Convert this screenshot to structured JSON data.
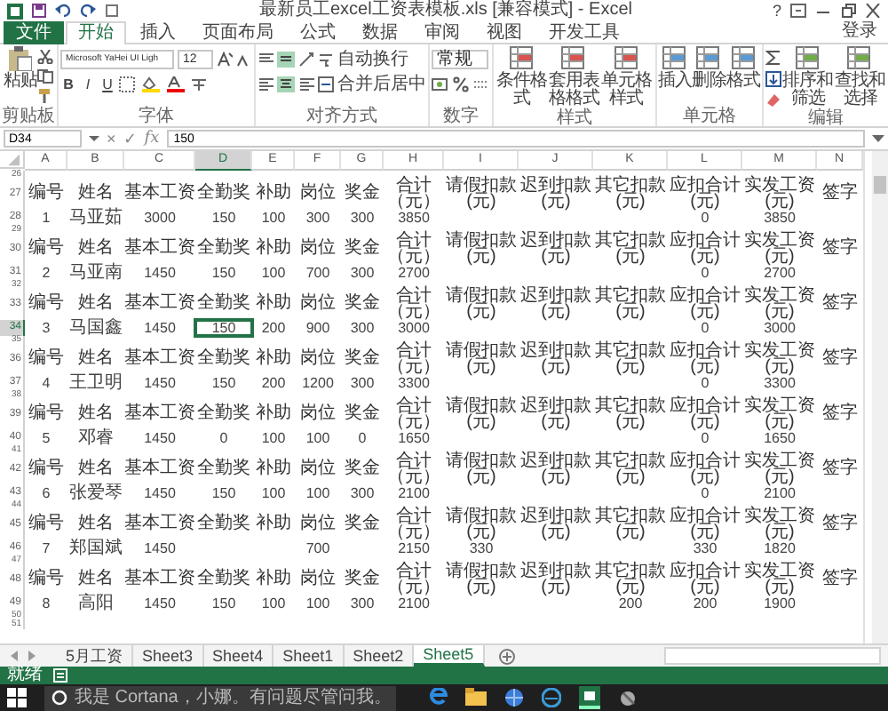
{
  "title_bar": {
    "title": "最新员工excel工资表模板.xls [兼容模式] - Excel",
    "help": "?"
  },
  "ribbon_tabs": [
    {
      "label": "文件",
      "kind": "file",
      "selected": false
    },
    {
      "label": "开始",
      "kind": "tab",
      "selected": true
    },
    {
      "label": "插入",
      "kind": "tab",
      "selected": false
    },
    {
      "label": "页面布局",
      "kind": "tab",
      "selected": false
    },
    {
      "label": "公式",
      "kind": "tab",
      "selected": false
    },
    {
      "label": "数据",
      "kind": "tab",
      "selected": false
    },
    {
      "label": "审阅",
      "kind": "tab",
      "selected": false
    },
    {
      "label": "视图",
      "kind": "tab",
      "selected": false
    },
    {
      "label": "开发工具",
      "kind": "tab",
      "selected": false
    }
  ],
  "account": "登录",
  "ribbon_groups": [
    {
      "label": "剪贴板",
      "items": [
        {
          "kind": "large",
          "label": "粘贴"
        },
        {
          "kind": "clip-tools"
        }
      ]
    },
    {
      "label": "字体",
      "items": [
        {
          "kind": "font-controls",
          "font": "Microsoft YaHei UI Ligh",
          "size": "12",
          "styles": [
            "B",
            "I",
            "U"
          ]
        }
      ]
    },
    {
      "label": "对齐方式",
      "items": [
        {
          "kind": "align-controls",
          "wrap": "自动换行",
          "merge": "合并后居中"
        }
      ]
    },
    {
      "label": "数字",
      "items": [
        {
          "kind": "number-controls",
          "format": "常规"
        }
      ]
    },
    {
      "label": "样式",
      "items": [
        {
          "kind": "large",
          "label": "条件格式"
        },
        {
          "kind": "large",
          "label": "套用表格格式"
        },
        {
          "kind": "large",
          "label": "单元格样式"
        }
      ]
    },
    {
      "label": "单元格",
      "items": [
        {
          "kind": "large",
          "label": "插入"
        },
        {
          "kind": "large",
          "label": "删除"
        },
        {
          "kind": "large",
          "label": "格式"
        }
      ]
    },
    {
      "label": "编辑",
      "items": [
        {
          "kind": "sum-tools"
        },
        {
          "kind": "large",
          "label": "排序和筛选"
        },
        {
          "kind": "large",
          "label": "查找和选择"
        }
      ]
    }
  ],
  "formula_bar": {
    "name_box": "D34",
    "cancel": "×",
    "enter": "✓",
    "function_label": "fx",
    "value": "150"
  },
  "grid": {
    "columns": [
      {
        "label": "A",
        "selected": false
      },
      {
        "label": "B",
        "selected": false
      },
      {
        "label": "C",
        "selected": false
      },
      {
        "label": "D",
        "selected": true
      },
      {
        "label": "E",
        "selected": false
      },
      {
        "label": "F",
        "selected": false
      },
      {
        "label": "G",
        "selected": false
      },
      {
        "label": "H",
        "selected": false
      },
      {
        "label": "I",
        "selected": false
      },
      {
        "label": "J",
        "selected": false
      },
      {
        "label": "K",
        "selected": false
      },
      {
        "label": "L",
        "selected": false
      },
      {
        "label": "M",
        "selected": false
      },
      {
        "label": "N",
        "selected": false
      }
    ],
    "rows": [
      {
        "number": "26",
        "kind": "blank",
        "selected": false
      },
      {
        "number": "27",
        "kind": "header",
        "selected": false,
        "labels": [
          "编号",
          "姓名",
          "基本工资",
          "全勤奖",
          "补助",
          "岗位",
          "奖金",
          "合计（元）",
          "请假扣款(元)",
          "迟到扣款(元)",
          "其它扣款(元)",
          "应扣合计(元)",
          "实发工资(元)",
          "签字"
        ]
      },
      {
        "number": "28",
        "kind": "record",
        "selected": false,
        "cells": {
          "no": "1",
          "name": "马亚茹",
          "base": "3000",
          "attendance": "150",
          "subsidy": "100",
          "post": "300",
          "bonus": "300",
          "total": "3850",
          "deduction_total": "0",
          "net": "3850"
        }
      },
      {
        "number": "29",
        "kind": "blank",
        "selected": false
      },
      {
        "number": "30",
        "kind": "header",
        "selected": false,
        "labels": [
          "编号",
          "姓名",
          "基本工资",
          "全勤奖",
          "补助",
          "岗位",
          "奖金",
          "合计（元）",
          "请假扣款(元)",
          "迟到扣款(元)",
          "其它扣款(元)",
          "应扣合计(元)",
          "实发工资(元)",
          "签字"
        ]
      },
      {
        "number": "31",
        "kind": "record",
        "selected": false,
        "cells": {
          "no": "2",
          "name": "马亚南",
          "base": "1450",
          "attendance": "150",
          "subsidy": "100",
          "post": "700",
          "bonus": "300",
          "total": "2700",
          "deduction_total": "0",
          "net": "2700"
        }
      },
      {
        "number": "32",
        "kind": "blank",
        "selected": false
      },
      {
        "number": "33",
        "kind": "header",
        "selected": false,
        "labels": [
          "编号",
          "姓名",
          "基本工资",
          "全勤奖",
          "补助",
          "岗位",
          "奖金",
          "合计（元）",
          "请假扣款(元)",
          "迟到扣款(元)",
          "其它扣款(元)",
          "应扣合计(元)",
          "实发工资(元)",
          "签字"
        ]
      },
      {
        "number": "34",
        "kind": "record",
        "selected": true,
        "cells": {
          "no": "3",
          "name": "马国鑫",
          "base": "1450",
          "attendance": "150",
          "subsidy": "200",
          "post": "900",
          "bonus": "300",
          "total": "3000",
          "deduction_total": "0",
          "net": "3000"
        }
      },
      {
        "number": "35",
        "kind": "blank",
        "selected": false
      },
      {
        "number": "36",
        "kind": "header",
        "selected": false,
        "labels": [
          "编号",
          "姓名",
          "基本工资",
          "全勤奖",
          "补助",
          "岗位",
          "奖金",
          "合计（元）",
          "请假扣款(元)",
          "迟到扣款(元)",
          "其它扣款(元)",
          "应扣合计(元)",
          "实发工资(元)",
          "签字"
        ]
      },
      {
        "number": "37",
        "kind": "record",
        "selected": false,
        "cells": {
          "no": "4",
          "name": "王卫明",
          "base": "1450",
          "attendance": "150",
          "subsidy": "200",
          "post": "1200",
          "bonus": "300",
          "total": "3300",
          "deduction_total": "0",
          "net": "3300"
        }
      },
      {
        "number": "38",
        "kind": "blank",
        "selected": false
      },
      {
        "number": "39",
        "kind": "header",
        "selected": false,
        "labels": [
          "编号",
          "姓名",
          "基本工资",
          "全勤奖",
          "补助",
          "岗位",
          "奖金",
          "合计（元）",
          "请假扣款(元)",
          "迟到扣款(元)",
          "其它扣款(元)",
          "应扣合计(元)",
          "实发工资(元)",
          "签字"
        ]
      },
      {
        "number": "40",
        "kind": "record",
        "selected": false,
        "cells": {
          "no": "5",
          "name": "邓睿",
          "base": "1450",
          "attendance": "0",
          "subsidy": "100",
          "post": "100",
          "bonus": "0",
          "total": "1650",
          "deduction_total": "0",
          "net": "1650"
        }
      },
      {
        "number": "41",
        "kind": "blank",
        "selected": false
      },
      {
        "number": "42",
        "kind": "header",
        "selected": false,
        "labels": [
          "编号",
          "姓名",
          "基本工资",
          "全勤奖",
          "补助",
          "岗位",
          "奖金",
          "合计（元）",
          "请假扣款(元)",
          "迟到扣款(元)",
          "其它扣款(元)",
          "应扣合计(元)",
          "实发工资(元)",
          "签字"
        ]
      },
      {
        "number": "43",
        "kind": "record",
        "selected": false,
        "cells": {
          "no": "6",
          "name": "张爱琴",
          "base": "1450",
          "attendance": "150",
          "subsidy": "100",
          "post": "100",
          "bonus": "300",
          "total": "2100",
          "deduction_total": "0",
          "net": "2100"
        }
      },
      {
        "number": "44",
        "kind": "blank",
        "selected": false
      },
      {
        "number": "45",
        "kind": "header",
        "selected": false,
        "labels": [
          "编号",
          "姓名",
          "基本工资",
          "全勤奖",
          "补助",
          "岗位",
          "奖金",
          "合计（元）",
          "请假扣款(元)",
          "迟到扣款(元)",
          "其它扣款(元)",
          "应扣合计(元)",
          "实发工资(元)",
          "签字"
        ]
      },
      {
        "number": "46",
        "kind": "record",
        "selected": false,
        "cells": {
          "no": "7",
          "name": "郑国斌",
          "base": "1450",
          "post": "700",
          "total": "2150",
          "leave_deduction": "330",
          "deduction_total": "330",
          "net": "1820"
        }
      },
      {
        "number": "47",
        "kind": "blank",
        "selected": false
      },
      {
        "number": "48",
        "kind": "header",
        "selected": false,
        "labels": [
          "编号",
          "姓名",
          "基本工资",
          "全勤奖",
          "补助",
          "岗位",
          "奖金",
          "合计（元）",
          "请假扣款(元)",
          "迟到扣款(元)",
          "其它扣款(元)",
          "应扣合计(元)",
          "实发工资(元)",
          "签字"
        ]
      },
      {
        "number": "49",
        "kind": "record",
        "selected": false,
        "cells": {
          "no": "8",
          "name": "高阳",
          "base": "1450",
          "attendance": "150",
          "subsidy": "100",
          "post": "100",
          "bonus": "300",
          "total": "2100",
          "other_deduction": "200",
          "deduction_total": "200",
          "net": "1900"
        }
      },
      {
        "number": "50",
        "kind": "blank",
        "selected": false
      },
      {
        "number": "51",
        "kind": "blank",
        "selected": false
      }
    ]
  },
  "sheet_tabs": [
    {
      "label": "5月工资",
      "selected": false
    },
    {
      "label": "Sheet3",
      "selected": false
    },
    {
      "label": "Sheet4",
      "selected": false
    },
    {
      "label": "Sheet1",
      "selected": false
    },
    {
      "label": "Sheet2",
      "selected": false
    },
    {
      "label": "Sheet5",
      "selected": true
    }
  ],
  "status_bar": {
    "text": "就绪"
  },
  "taskbar": {
    "search_placeholder": "我是 Cortana，小娜。有问题尽管问我。"
  }
}
